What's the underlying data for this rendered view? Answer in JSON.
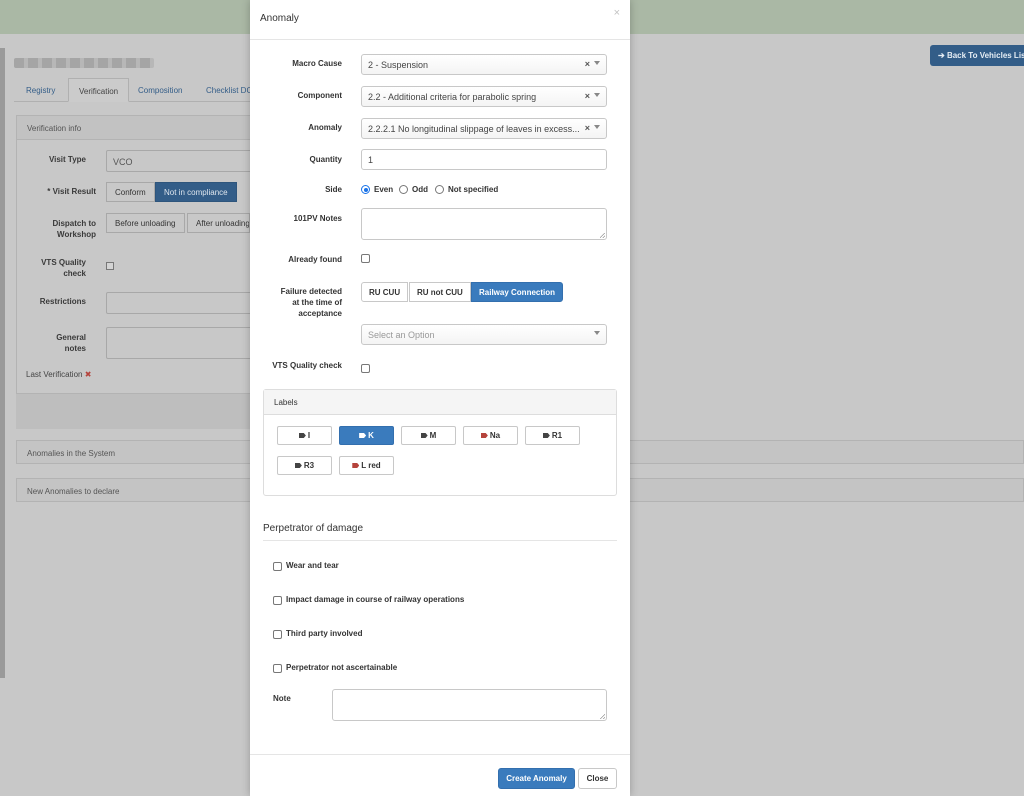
{
  "background": {
    "back_button": "Back To Vehicles List",
    "tabs": [
      "Registry",
      "Verification",
      "Composition",
      "Checklist DC"
    ],
    "verification_panel_title": "Verification info",
    "visit_type_label": "Visit Type",
    "visit_type_value": "VCO",
    "visit_result_label": "Visit Result",
    "visit_result_required": "*",
    "visit_result_options": [
      "Conform",
      "Not in compliance"
    ],
    "dispatch_label_1": "Dispatch to",
    "dispatch_label_2": "Workshop",
    "dispatch_options": [
      "Before unloading",
      "After unloading"
    ],
    "vts_label_1": "VTS Quality",
    "vts_label_2": "check",
    "restrictions_label": "Restrictions",
    "general_notes_label_1": "General",
    "general_notes_label_2": "notes",
    "last_verification_label": "Last Verification",
    "last_verification_mark": "✖",
    "anomalies_system": "Anomalies in the System",
    "new_anomalies": "New Anomalies to declare"
  },
  "modal": {
    "title": "Anomaly",
    "close_glyph": "×",
    "macro_cause_label": "Macro Cause",
    "macro_cause_value": "2 - Suspension",
    "component_label": "Component",
    "component_value": "2.2 - Additional criteria for parabolic spring",
    "anomaly_label": "Anomaly",
    "anomaly_value": "2.2.2.1 No longitudinal slippage of leaves in excess...",
    "clear_glyph": "×",
    "quantity_label": "Quantity",
    "quantity_value": "1",
    "side_label": "Side",
    "side_options": [
      "Even",
      "Odd",
      "Not specified"
    ],
    "side_selected": "Even",
    "notes_101pv_label": "101PV Notes",
    "already_found_label": "Already found",
    "failure_label_1": "Failure detected",
    "failure_label_2": "at the time of",
    "failure_label_3": "acceptance",
    "failure_options": [
      "RU CUU",
      "RU not CUU",
      "Railway Connection"
    ],
    "failure_selected": "Railway Connection",
    "option_placeholder": "Select an Option",
    "vts_quality_label": "VTS Quality check",
    "labels_title": "Labels",
    "labels": [
      {
        "text": "I",
        "color": "#444444"
      },
      {
        "text": "K",
        "color": "#ffffff"
      },
      {
        "text": "M",
        "color": "#444444"
      },
      {
        "text": "Na",
        "color": "#b5433c"
      },
      {
        "text": "R1",
        "color": "#444444"
      },
      {
        "text": "R3",
        "color": "#444444"
      },
      {
        "text": "L red",
        "color": "#b5433c"
      }
    ],
    "labels_selected": "K",
    "perpetrator_title": "Perpetrator of damage",
    "perpetrator_options": [
      "Wear and tear",
      "Impact damage in course of railway operations",
      "Third party involved",
      "Perpetrator not ascertainable"
    ],
    "note_label": "Note",
    "create_button": "Create Anomaly",
    "close_button": "Close",
    "accent_color": "#3a7bbd"
  }
}
